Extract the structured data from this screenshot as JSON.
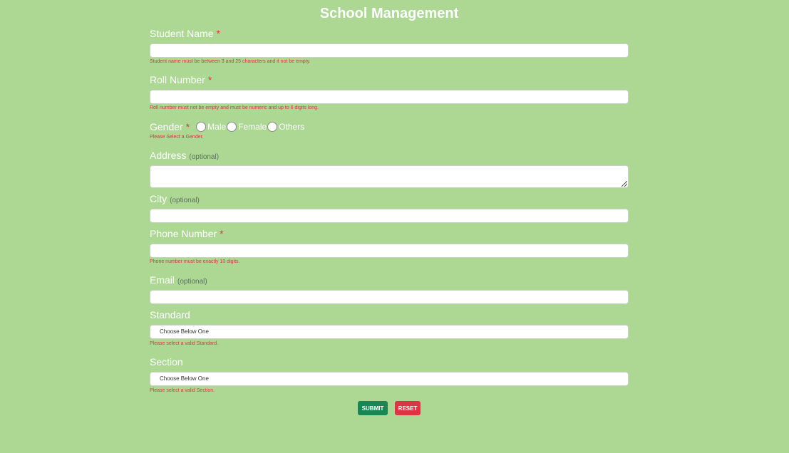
{
  "title": "School Management",
  "required_mark": "*",
  "optional_mark": "(optional)",
  "fields": {
    "student_name": {
      "label": "Student Name",
      "value": "",
      "error": "Student name must be between 3 and 25 characters and it not be empty."
    },
    "roll_number": {
      "label": "Roll Number",
      "value": "",
      "error": "Roll number must not be empty and must be numeric and up to 6 digits long."
    },
    "gender": {
      "label": "Gender",
      "options": [
        "Male",
        "Female",
        "Others"
      ],
      "error": "Please Select a Gender."
    },
    "address": {
      "label": "Address",
      "value": ""
    },
    "city": {
      "label": "City",
      "value": ""
    },
    "phone_number": {
      "label": "Phone Number",
      "value": "",
      "error": "Phone number must be exactly 10 digits."
    },
    "email": {
      "label": "Email",
      "value": ""
    },
    "standard": {
      "label": "Standard",
      "selected": "Choose Below One",
      "error": "Please select a valid Standard."
    },
    "section": {
      "label": "Section",
      "selected": "Choose Below One",
      "error": "Please select a valid Section."
    }
  },
  "buttons": {
    "submit": "SUBMIT",
    "reset": "RESET"
  },
  "colors": {
    "background": "#acd893",
    "error": "#dc3545",
    "submit": "#198754",
    "reset": "#dc3545"
  }
}
